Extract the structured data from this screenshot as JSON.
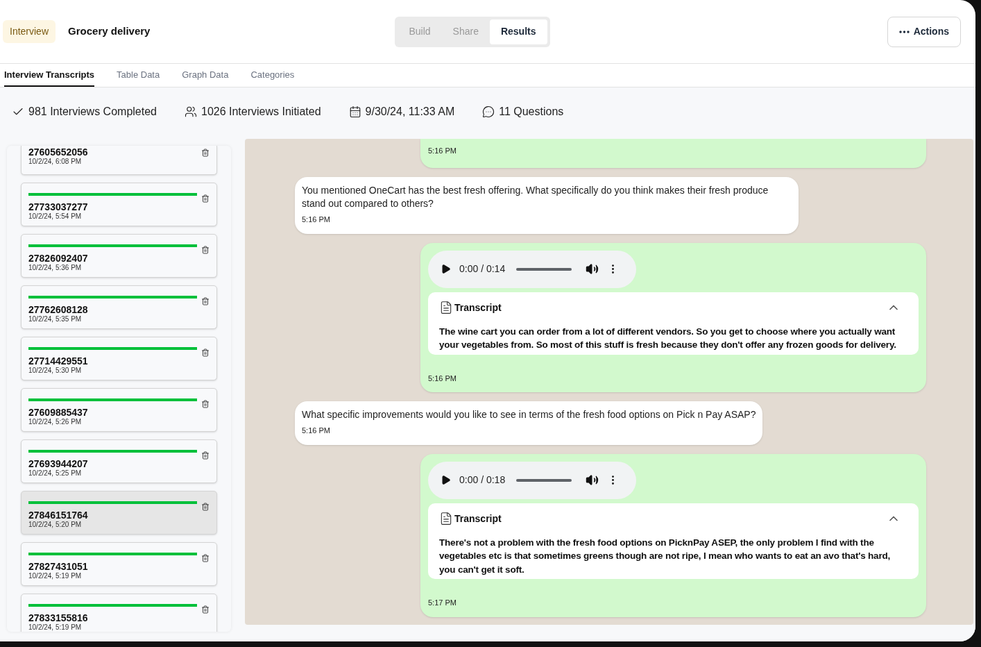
{
  "header": {
    "badge": "Interview",
    "title": "Grocery delivery",
    "modes": [
      {
        "label": "Build",
        "selected": false
      },
      {
        "label": "Share",
        "selected": false
      },
      {
        "label": "Results",
        "selected": true
      }
    ],
    "actions": "Actions"
  },
  "tabs": [
    {
      "label": "Interview Transcripts",
      "selected": true
    },
    {
      "label": "Table Data",
      "selected": false
    },
    {
      "label": "Graph Data",
      "selected": false
    },
    {
      "label": "Categories",
      "selected": false
    }
  ],
  "stats": [
    {
      "kind": "check",
      "text": "981 Interviews Completed"
    },
    {
      "kind": "users",
      "text": "1026 Interviews Initiated"
    },
    {
      "kind": "calendar",
      "text": "9/30/24, 11:33 AM"
    },
    {
      "kind": "chat",
      "text": "11 Questions"
    }
  ],
  "interviews": [
    {
      "id": "27605652056",
      "date": "10/2/24, 6:08 PM",
      "selected": false
    },
    {
      "id": "27733037277",
      "date": "10/2/24, 5:54 PM",
      "selected": false,
      "completed": true
    },
    {
      "id": "27826092407",
      "date": "10/2/24, 5:36 PM",
      "selected": false,
      "completed": true
    },
    {
      "id": "27762608128",
      "date": "10/2/24, 5:35 PM",
      "selected": false,
      "completed": true
    },
    {
      "id": "27714429551",
      "date": "10/2/24, 5:30 PM",
      "selected": false,
      "completed": true
    },
    {
      "id": "27609885437",
      "date": "10/2/24, 5:26 PM",
      "selected": false,
      "completed": true
    },
    {
      "id": "27693944207",
      "date": "10/2/24, 5:25 PM",
      "selected": false,
      "completed": true
    },
    {
      "id": "27846151764",
      "date": "10/2/24, 5:20 PM",
      "selected": true,
      "completed": true
    },
    {
      "id": "27827431051",
      "date": "10/2/24, 5:19 PM",
      "selected": false,
      "completed": true
    },
    {
      "id": "27833155816",
      "date": "10/2/24, 5:19 PM",
      "selected": false,
      "completed": true
    }
  ],
  "messages": [
    {
      "kind": "answer_end",
      "time": "5:16 PM"
    },
    {
      "kind": "question",
      "text": "You mentioned OneCart has the best fresh offering. What specifically do you think makes their fresh produce stand out compared to others?",
      "time": "5:16 PM"
    },
    {
      "kind": "audio",
      "player_time": "0:00 / 0:14",
      "transcript_label": "Transcript",
      "expanded": true,
      "transcript": "The wine cart you can order from a lot of different vendors. So you get to choose where you actually want your vegetables from. So most of this stuff is fresh because they don't offer any frozen goods for delivery.",
      "time": "5:16 PM"
    },
    {
      "kind": "question",
      "text": "What specific improvements would you like to see in terms of the fresh food options on Pick n Pay ASAP?",
      "time": "5:16 PM"
    },
    {
      "kind": "audio",
      "player_time": "0:00 / 0:18",
      "transcript_label": "Transcript",
      "expanded": true,
      "transcript": "There's not a problem with the fresh food options on PicknPay ASEP, the only problem I find with the vegetables etc is that sometimes greens though are not ripe, I mean who wants to eat an avo that's hard, you can't get it soft.",
      "time": "5:17 PM"
    }
  ]
}
